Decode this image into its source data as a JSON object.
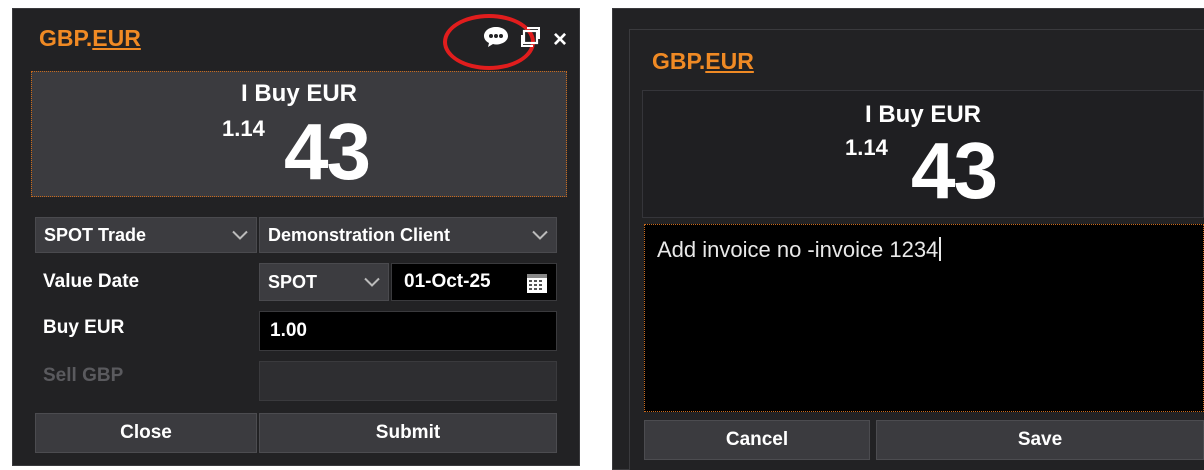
{
  "left_panel": {
    "title_base": "GBP.",
    "title_quote": "EUR",
    "icons": [
      "chat-bubble-icon",
      "popout-icon",
      "close-icon"
    ],
    "close_glyph": "×",
    "price": {
      "heading": "I Buy EUR",
      "small": "1.14",
      "big": "43"
    },
    "trade_type": "SPOT Trade",
    "client": "Demonstration Client",
    "value_date_label": "Value Date",
    "tenor": "SPOT",
    "date": "01-Oct-25",
    "buy_label": "Buy EUR",
    "buy_amount": "1.00",
    "sell_label": "Sell GBP",
    "sell_amount": "",
    "close_label": "Close",
    "submit_label": "Submit"
  },
  "right_panel": {
    "title_base": "GBP.",
    "title_quote": "EUR",
    "price": {
      "heading": "I Buy EUR",
      "small": "1.14",
      "big": "43"
    },
    "comment_text": "Add invoice no -invoice 1234",
    "cancel_label": "Cancel",
    "save_label": "Save"
  },
  "colors": {
    "accent": "#f08a24",
    "highlight": "#e11d1d",
    "panel_bg": "#222224",
    "control_bg": "#3c3c40",
    "field_bg": "#000000"
  }
}
